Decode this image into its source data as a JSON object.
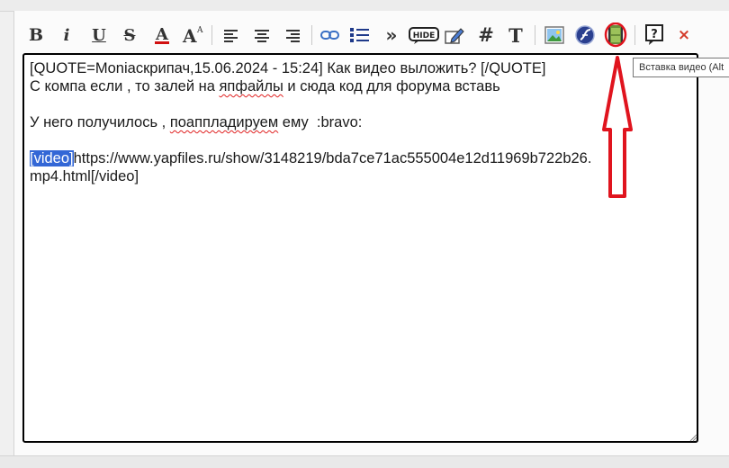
{
  "toolbar": {
    "buttons": [
      {
        "name": "bold",
        "glyph": "B"
      },
      {
        "name": "italic",
        "glyph": "i"
      },
      {
        "name": "underline",
        "glyph": "U"
      },
      {
        "name": "strikethrough",
        "glyph": "S"
      },
      {
        "name": "font-color",
        "glyph": "A"
      },
      {
        "name": "font-size",
        "glyph": "A"
      },
      {
        "name": "align-left"
      },
      {
        "name": "align-center"
      },
      {
        "name": "align-right"
      },
      {
        "name": "insert-link"
      },
      {
        "name": "bullet-list"
      },
      {
        "name": "indent",
        "glyph": "»"
      },
      {
        "name": "hide",
        "label": "HIDE"
      },
      {
        "name": "edit"
      },
      {
        "name": "hashtag",
        "glyph": "#"
      },
      {
        "name": "text-format",
        "glyph": "T"
      },
      {
        "name": "insert-image"
      },
      {
        "name": "insert-flash"
      },
      {
        "name": "insert-video"
      },
      {
        "name": "help",
        "glyph": "?"
      },
      {
        "name": "remove-format",
        "glyph": "×"
      }
    ],
    "colors": {
      "font_color_bar": "#d11010",
      "highlight_circle": "#e0141e",
      "arrow": "#e0141e",
      "selection": "#3367d6"
    }
  },
  "tooltip": {
    "text": "Вставка видео (Alt"
  },
  "editor": {
    "line1": "[QUOTE=Moniaскрипач,15.06.2024 - 15:24] Как видео выложить? [/QUOTE]",
    "line2_before": "С компа если , то залей на ",
    "line2_misspelled": "япфайлы",
    "line2_after": " и сюда код для форума вставь",
    "line3_before": "У него получилось , ",
    "line3_misspelled": "поаппладируем",
    "line3_after": " ему  :bravo:",
    "line4_selected": "[video]",
    "line4_after": "https://www.yapfiles.ru/show/3148219/bda7ce71ac555004e12d11969b722b26.",
    "line5": "mp4.html[/video]"
  }
}
